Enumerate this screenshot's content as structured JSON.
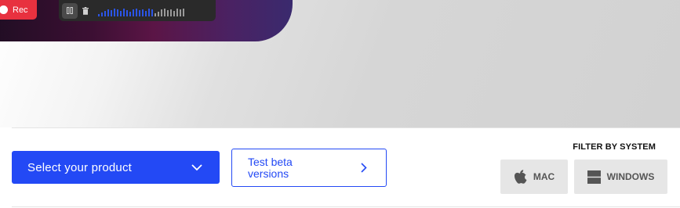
{
  "recorder": {
    "rec_label": "Rec"
  },
  "product_select": {
    "label": "Select your product"
  },
  "beta": {
    "label": "Test beta versions"
  },
  "filter": {
    "title": "FILTER BY SYSTEM",
    "options": [
      {
        "label": "MAC",
        "icon": "apple-icon"
      },
      {
        "label": "WINDOWS",
        "icon": "windows-icon"
      }
    ]
  },
  "colors": {
    "accent": "#2349f5",
    "rec_red": "#e8313f",
    "os_button_bg": "#e6e6e6"
  }
}
